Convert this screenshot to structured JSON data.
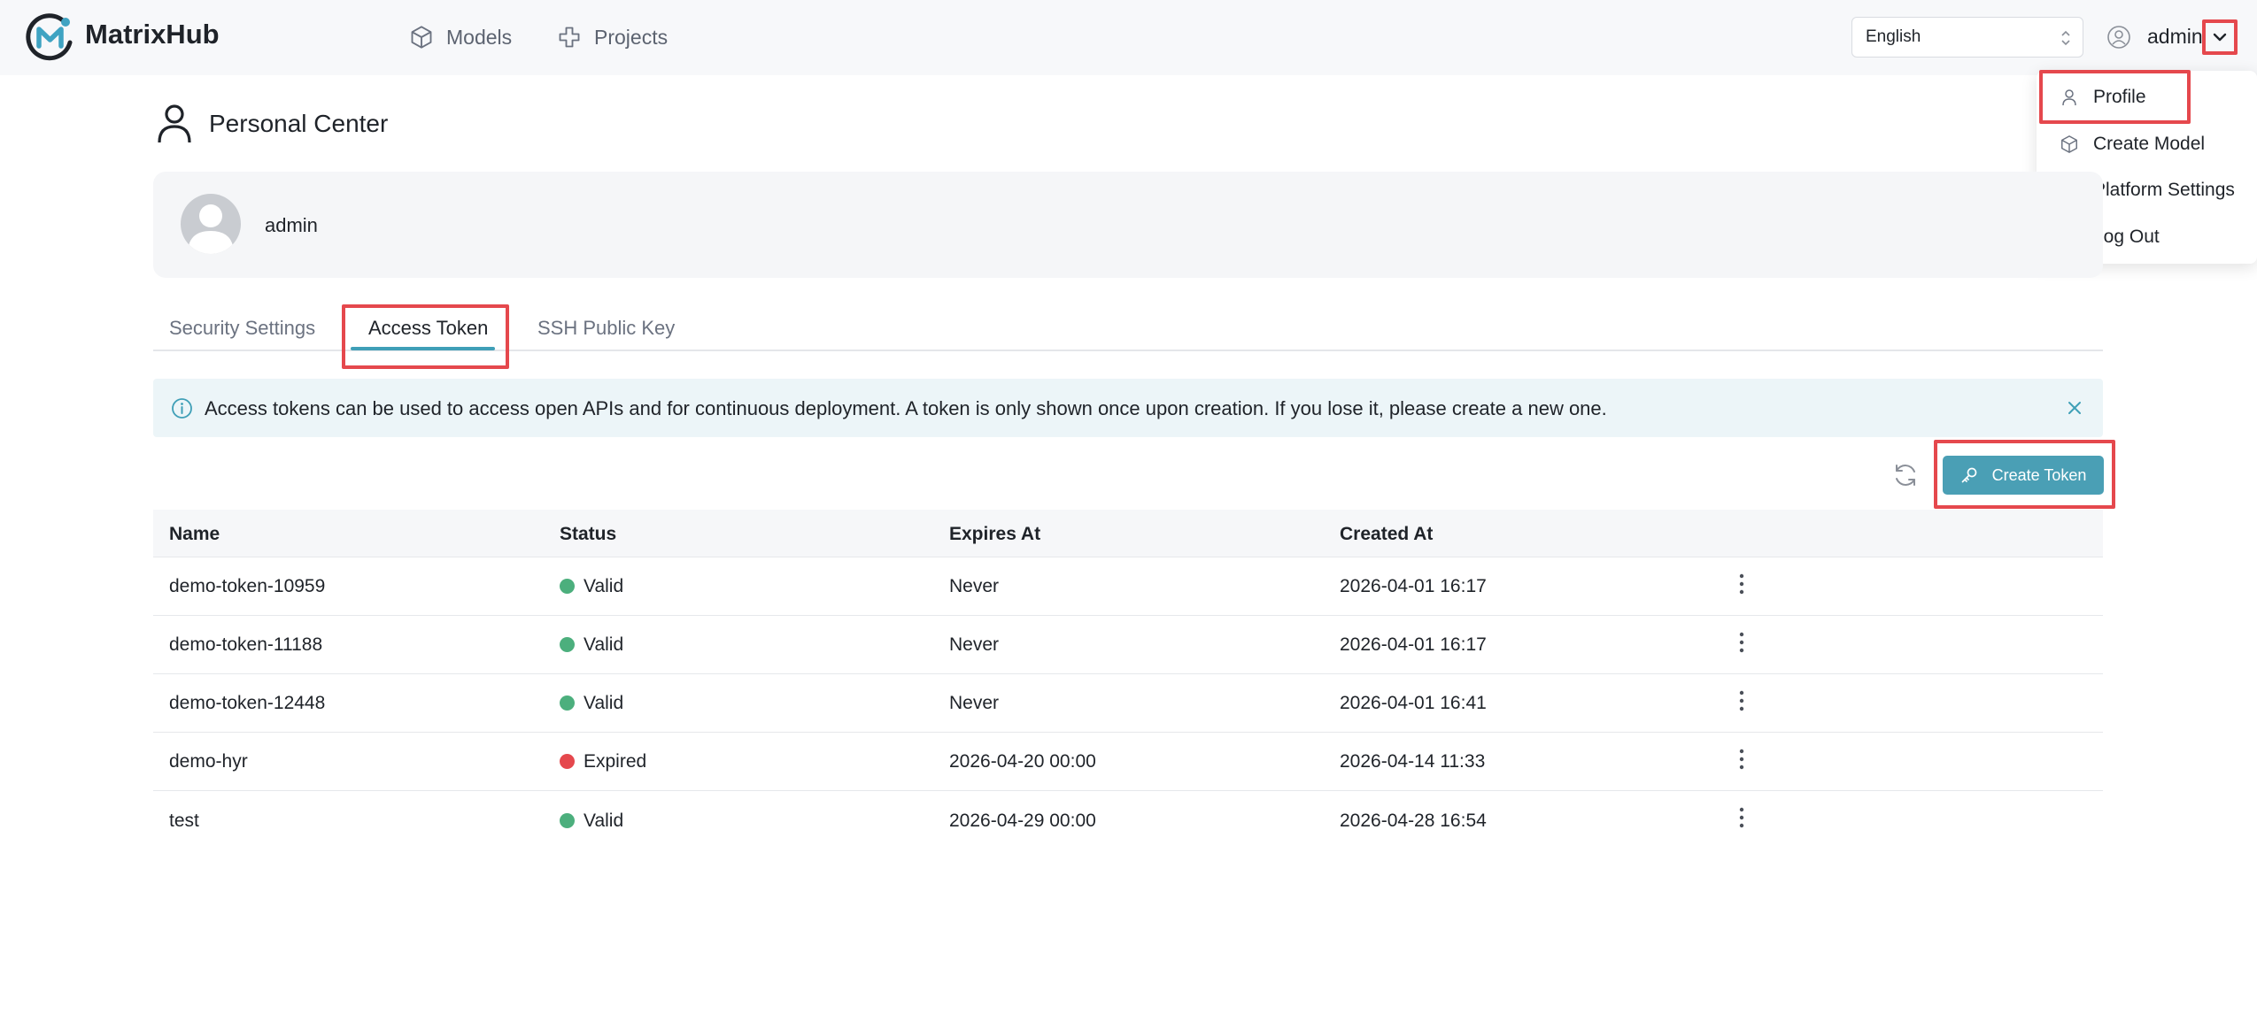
{
  "header": {
    "logo_text": "MatrixHub",
    "nav": [
      {
        "label": "Models",
        "icon": "cube-icon"
      },
      {
        "label": "Projects",
        "icon": "projects-icon"
      }
    ],
    "language": "English",
    "user": "admin"
  },
  "user_menu": {
    "items": [
      {
        "label": "Profile",
        "icon": "person-icon"
      },
      {
        "label": "Create Model",
        "icon": "cube-icon"
      },
      {
        "label": "Platform Settings",
        "icon": "gear-icon"
      },
      {
        "label": "Log Out",
        "icon": "logout-icon"
      }
    ]
  },
  "page": {
    "title": "Personal Center",
    "profile_name": "admin"
  },
  "tabs": [
    {
      "label": "Security Settings",
      "active": false
    },
    {
      "label": "Access Token",
      "active": true
    },
    {
      "label": "SSH Public Key",
      "active": false
    }
  ],
  "alert": {
    "text": "Access tokens can be used to access open APIs and for continuous deployment. A token is only shown once upon creation. If you lose it, please create a new one."
  },
  "toolbar": {
    "create_label": "Create Token"
  },
  "table": {
    "columns": [
      "Name",
      "Status",
      "Expires At",
      "Created At"
    ],
    "rows": [
      {
        "name": "demo-token-10959",
        "status": "Valid",
        "expires": "Never",
        "created": "2026-04-01 16:17"
      },
      {
        "name": "demo-token-11188",
        "status": "Valid",
        "expires": "Never",
        "created": "2026-04-01 16:17"
      },
      {
        "name": "demo-token-12448",
        "status": "Valid",
        "expires": "Never",
        "created": "2026-04-01 16:41"
      },
      {
        "name": "demo-hyr",
        "status": "Expired",
        "expires": "2026-04-20 00:00",
        "created": "2026-04-14 11:33"
      },
      {
        "name": "test",
        "status": "Valid",
        "expires": "2026-04-29 00:00",
        "created": "2026-04-28 16:54"
      }
    ]
  },
  "colors": {
    "accent": "#4a9fb5",
    "highlight": "#e5484d",
    "status_valid": "#4caf7d",
    "status_expired": "#e5484d"
  }
}
